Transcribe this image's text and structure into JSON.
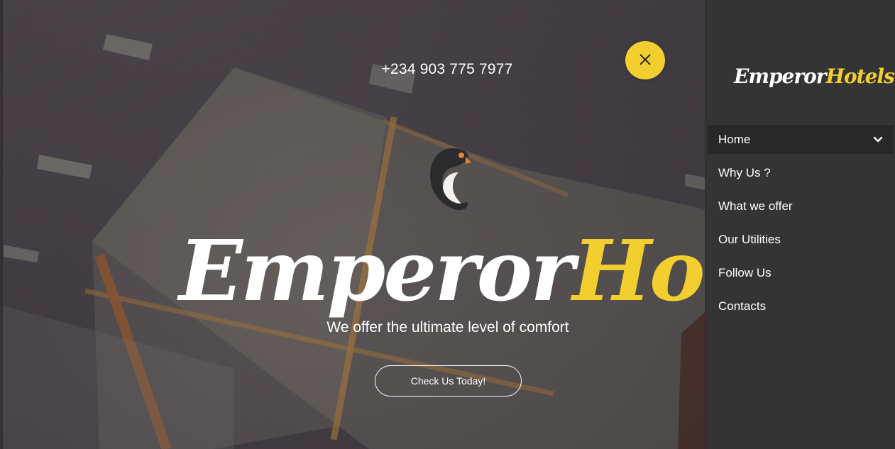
{
  "hero": {
    "phone": "+234 903 775 7977",
    "close_icon": "close-icon",
    "logo": {
      "word1": "Emperor",
      "word2": "Hotels"
    },
    "tagline": "We offer the ultimate level of comfort",
    "cta_label": "Check Us Today!"
  },
  "sidebar": {
    "logo": {
      "word1": "Emperor",
      "word2": "Hotels"
    },
    "items": [
      {
        "label": "Home",
        "active": true,
        "icon": "chevron-down-icon"
      },
      {
        "label": "Why Us ?"
      },
      {
        "label": "What we offer"
      },
      {
        "label": "Our Utilities"
      },
      {
        "label": "Follow Us"
      },
      {
        "label": "Contacts"
      }
    ]
  },
  "colors": {
    "accent": "#f2cf2e",
    "panel_bg": "#343434",
    "active_item_bg": "#272727",
    "text": "#ffffff"
  }
}
